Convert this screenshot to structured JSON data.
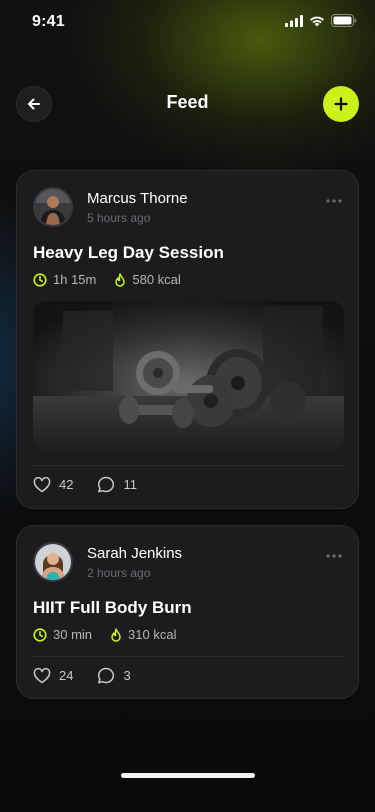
{
  "status_bar": {
    "time": "9:41"
  },
  "header": {
    "title": "Feed"
  },
  "posts": [
    {
      "author": "Marcus Thorne",
      "time_ago": "5 hours ago",
      "title": "Heavy Leg Day Session",
      "duration": "1h 15m",
      "calories": "580 kcal",
      "likes": "42",
      "comments": "11",
      "has_photo": true
    },
    {
      "author": "Sarah Jenkins",
      "time_ago": "2 hours ago",
      "title": "HIIT Full Body Burn",
      "duration": "30 min",
      "calories": "310 kcal",
      "likes": "24",
      "comments": "3",
      "has_photo": false
    }
  ],
  "colors": {
    "accent": "#c8f21a",
    "card": "#1c1c1e",
    "muted": "#6b6b70"
  },
  "icons": [
    "back-arrow-icon",
    "plus-icon",
    "clock-icon",
    "flame-icon",
    "heart-icon",
    "comment-icon",
    "more-dots-icon"
  ]
}
